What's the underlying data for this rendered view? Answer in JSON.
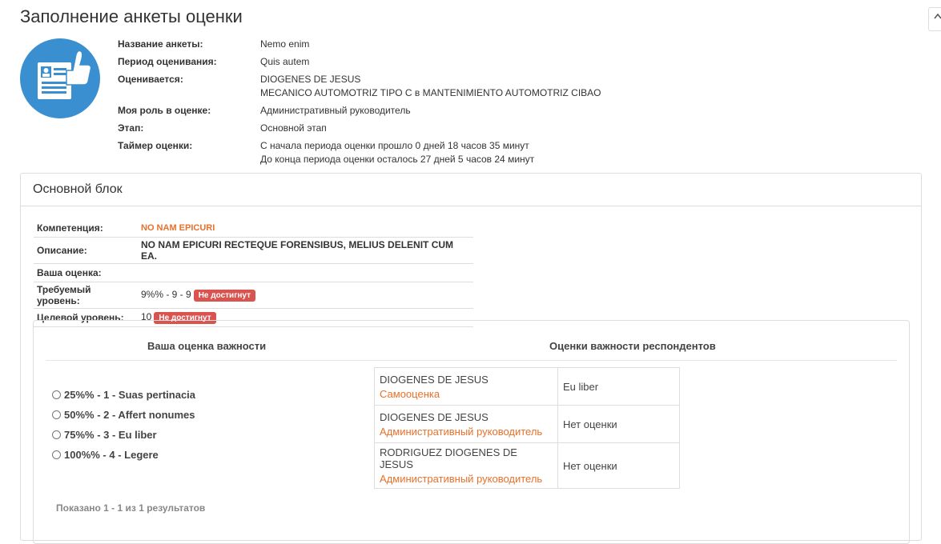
{
  "page": {
    "title": "Заполнение анкеты оценки"
  },
  "info": {
    "form_name_label": "Название анкеты:",
    "form_name": "Nemo enim",
    "period_label": "Период оценивания:",
    "period": "Quis autem",
    "evaluated_label": "Оценивается:",
    "evaluated_name": "DIOGENES DE JESUS",
    "evaluated_position": "MECANICO AUTOMOTRIZ TIPO C в MANTENIMIENTO AUTOMOTRIZ CIBAO",
    "role_label": "Моя роль в оценке:",
    "role": "Административный руководитель",
    "stage_label": "Этап:",
    "stage": "Основной этап",
    "timer_label": "Таймер оценки:",
    "timer_elapsed": "С начала периода оценки прошло 0 дней 18 часов 35 минут",
    "timer_remaining": "До конца периода оценки осталось 27 дней 5 часов 24 минут"
  },
  "block": {
    "title": "Основной блок",
    "competence_label": "Компетенция:",
    "competence": "NO NAM EPICURI",
    "description_label": "Описание:",
    "description": "NO NAM EPICURI RECTEQUE FORENSIBUS, MELIUS DELENIT CUM EA.",
    "your_score_label": "Ваша оценка:",
    "your_score": "",
    "required_label": "Требуемый уровень:",
    "required_value": "9%% - 9 - 9",
    "required_badge": "Не достигнут",
    "target_label": "Целевой уровень:",
    "target_value": "10",
    "target_badge": "Не достигнут"
  },
  "importance": {
    "your_heading": "Ваша оценка важности",
    "resp_heading": "Оценки важности респондентов",
    "options": [
      "25%% - 1 - Suas pertinacia",
      "50%% - 2 - Affert nonumes",
      "75%% - 3 - Eu liber",
      "100%% - 4 - Legere"
    ],
    "respondents": [
      {
        "name": "DIOGENES DE JESUS",
        "role": "Самооценка",
        "score": "Eu liber"
      },
      {
        "name": "DIOGENES DE JESUS",
        "role": "Административный руководитель",
        "score": "Нет оценки"
      },
      {
        "name": "RODRIGUEZ DIOGENES DE JESUS",
        "role": "Административный руководитель",
        "score": "Нет оценки"
      }
    ],
    "summary": "Показано 1 - 1 из 1 результатов"
  }
}
